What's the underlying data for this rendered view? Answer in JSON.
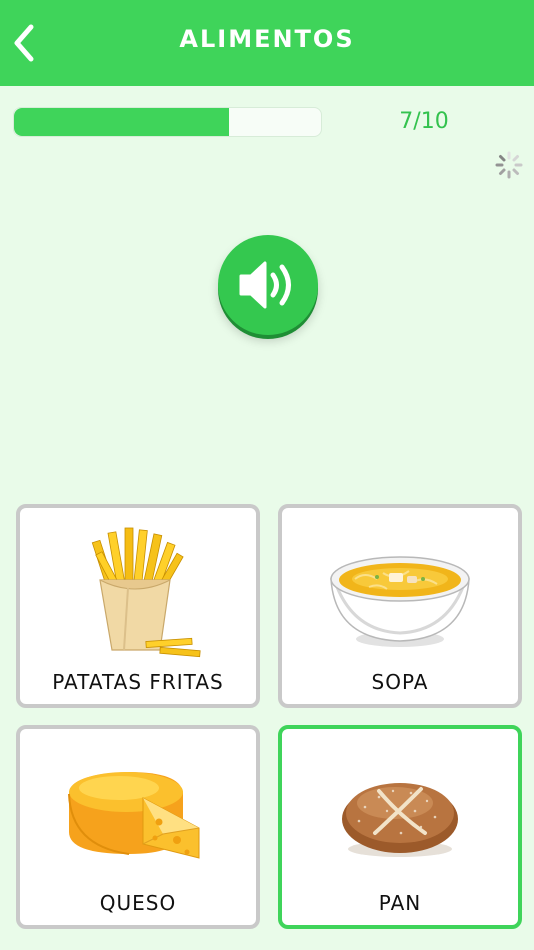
{
  "header": {
    "title": "ALIMENTOS",
    "back_icon": "chevron-left-icon"
  },
  "progress": {
    "current": 7,
    "total": 10,
    "label": "7/10",
    "fraction": 0.7
  },
  "audio": {
    "icon": "speaker-icon"
  },
  "options": [
    {
      "label": "PATATAS FRITAS",
      "icon": "french-fries-image",
      "selected": false
    },
    {
      "label": "SOPA",
      "icon": "soup-bowl-image",
      "selected": false
    },
    {
      "label": "QUESO",
      "icon": "cheese-image",
      "selected": false
    },
    {
      "label": "PAN",
      "icon": "bread-image",
      "selected": true
    }
  ],
  "colors": {
    "brand_green": "#3fd45a",
    "background": "#e9fbe9",
    "card_border": "#c9c9c9"
  }
}
